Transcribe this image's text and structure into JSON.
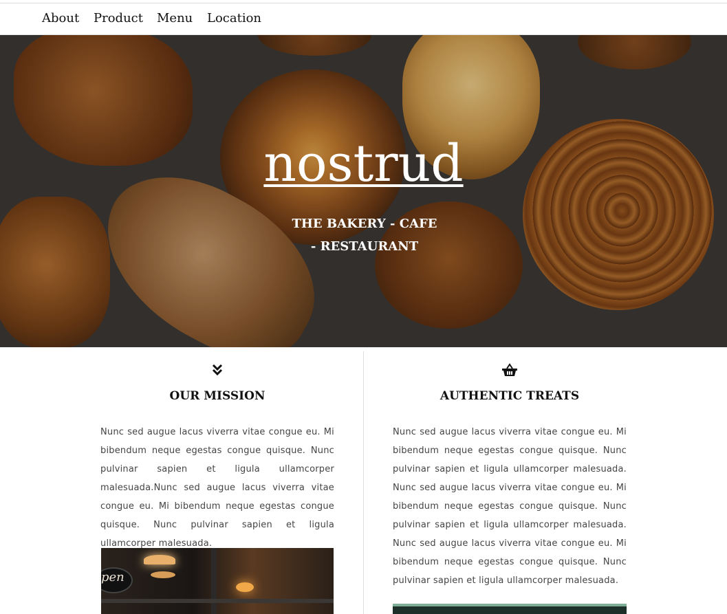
{
  "nav": {
    "items": [
      "About",
      "Product",
      "Menu",
      "Location"
    ]
  },
  "hero": {
    "title": "nostrud",
    "subtitle": "THE BAKERY - CAFE - RESTAURANT"
  },
  "mission": {
    "icon": "double-chevron-down-icon",
    "heading": "OUR MISSION",
    "text": "Nunc sed augue lacus viverra vitae congue eu. Mi bibendum neque egestas congue quisque. Nunc pulvinar sapien et ligula ullamcorper malesuada.Nunc sed augue lacus viverra vitae congue eu. Mi bibendum neque egestas congue quisque. Nunc pulvinar sapien et ligula ullamcorper malesuada."
  },
  "treats": {
    "icon": "basket-icon",
    "heading": "AUTHENTIC TREATS",
    "text": "Nunc sed augue lacus viverra vitae congue eu. Mi bibendum neque egestas congue quisque. Nunc pulvinar sapien et ligula ullamcorper malesuada. Nunc sed augue lacus viverra vitae congue eu. Mi bibendum neque egestas congue quisque. Nunc pulvinar sapien et ligula ullamcorper malesuada. Nunc sed augue lacus viverra vitae congue eu. Mi bibendum neque egestas congue quisque. Nunc pulvinar sapien et ligula ullamcorper malesuada."
  },
  "photos": {
    "sign_text": "pen"
  },
  "colors": {
    "hero_background": "#3f3a37",
    "text": "#111111",
    "body_text": "#444444"
  }
}
